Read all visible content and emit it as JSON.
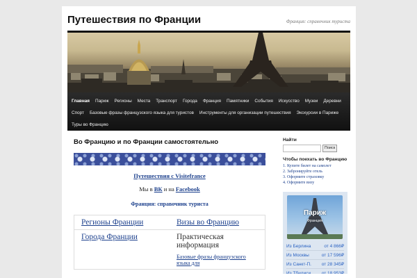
{
  "header": {
    "title": "Путешествия по Франции",
    "description": "Франция: справочник туриста"
  },
  "nav": {
    "items": [
      {
        "label": "Главная",
        "active": true
      },
      {
        "label": "Париж"
      },
      {
        "label": "Регионы"
      },
      {
        "label": "Места"
      },
      {
        "label": "Транспорт"
      },
      {
        "label": "Города"
      },
      {
        "label": "Франция"
      },
      {
        "label": "Памятники"
      },
      {
        "label": "События"
      },
      {
        "label": "Искусство"
      },
      {
        "label": "Музеи"
      },
      {
        "label": "Деревни"
      },
      {
        "label": "Спорт"
      },
      {
        "label": "Базовые фразы французского языка для туристов"
      },
      {
        "label": "Инструменты для организации путешествия"
      },
      {
        "label": "Экскурсии в Париже"
      },
      {
        "label": "Туры во Францию"
      }
    ]
  },
  "main": {
    "post_title": "Во Францию и по Франции самостоятельно",
    "visit_link": "Путешествия с Visitefrance",
    "social_prefix": "Мы в",
    "social_vk": "ВК",
    "social_and": "и на",
    "social_fb": "Facebook",
    "guide": "Франция: справочник туриста",
    "grid": [
      {
        "left": "Регионы Франции",
        "right": "Визы во Францию",
        "right_is_link": true
      },
      {
        "left": "Города Франции",
        "right": "Практическая информация",
        "right_is_link": false,
        "right_sub": "Базовые фразы французского языка для"
      }
    ]
  },
  "sidebar": {
    "search_title": "Найти",
    "search_button": "Поиск",
    "search_placeholder": "",
    "travel_title": "Чтобы поехать во Францию",
    "travel_items": [
      "1. Купите билет на самолет",
      "2. Забронируйте отель",
      "3. Оформите страховку",
      "4. Оформите визу"
    ],
    "paris_card": {
      "city": "Париж",
      "country": "Франция"
    },
    "fares": [
      {
        "from": "Из Берлина",
        "price": "от 4 866₽"
      },
      {
        "from": "Из Москвы",
        "price": "от 17 596₽"
      },
      {
        "from": "Из Санкт-П.",
        "price": "от 28 345₽"
      },
      {
        "from": "Из Тбилиси",
        "price": "от 18 953₽"
      }
    ]
  },
  "colors": {
    "link": "#1b3f8c",
    "nav_bg": "#1b1b1b",
    "fare_text": "#2a62c2"
  }
}
